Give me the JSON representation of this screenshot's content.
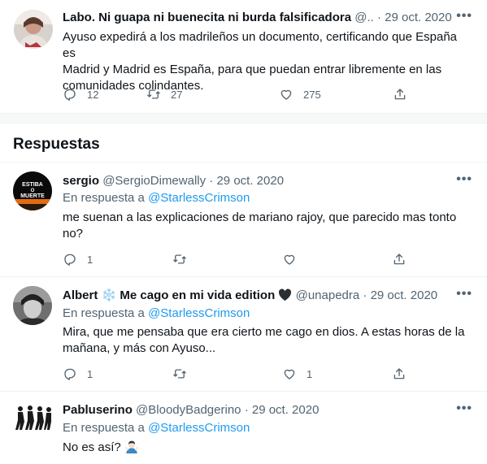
{
  "main_tweet": {
    "name": "Labo. Ni guapa ni buenecita ni burda falsificadora",
    "handle": "@..",
    "separator": "·",
    "date": "29 oct. 2020",
    "more": "•••",
    "text_line1": "Ayuso expedirá a los madrileños un documento, certificando que España es",
    "text_line2": "Madrid y Madrid es España, para que puedan entrar libremente en las",
    "text_line3": "comunidades colindantes.",
    "reply_count": "12",
    "retweet_count": "27",
    "like_count": "275"
  },
  "section": {
    "title": "Respuestas"
  },
  "replies": [
    {
      "name": "sergio",
      "handle": "@SergioDimewally",
      "separator": "·",
      "date": "29 oct. 2020",
      "more": "•••",
      "replying_prefix": "En respuesta a",
      "replying_to": "@StarlessCrimson",
      "text_line1": "me suenan a las explicaciones de mariano rajoy, que parecido mas tonto",
      "text_line2": "no?",
      "reply_count": "1",
      "retweet_count": "",
      "like_count": "",
      "avatar_text_top": "ESTIBA",
      "avatar_text_mid": "O",
      "avatar_text_bot": "MUERTE"
    },
    {
      "name": "Albert",
      "name_emoji": "❄️",
      "name_suffix": "Me cago en mi vida edition",
      "handle": "@unapedra",
      "separator": "·",
      "date": "29 oct. 2020",
      "more": "•••",
      "replying_prefix": "En respuesta a",
      "replying_to": "@StarlessCrimson",
      "text_line1": "Mira, que me pensaba que era cierto me cago en dios. A estas horas de la",
      "text_line2": "mañana, y más con Ayuso...",
      "reply_count": "1",
      "retweet_count": "",
      "like_count": "1"
    },
    {
      "name": "Pabluserino",
      "handle": "@BloodyBadgerino",
      "separator": "·",
      "date": "29 oct. 2020",
      "more": "•••",
      "replying_prefix": "En respuesta a",
      "replying_to": "@StarlessCrimson",
      "text_line1": "No es así?"
    }
  ],
  "colors": {
    "accent": "#1d9bf0",
    "text": "#0f1419",
    "muted": "#536471",
    "divider": "#eff3f4"
  },
  "icons": [
    "more-icon",
    "reply-icon",
    "retweet-icon",
    "like-icon",
    "share-icon",
    "snowflake-emoji",
    "black-heart-emoji",
    "man-shrugging-emoji"
  ]
}
